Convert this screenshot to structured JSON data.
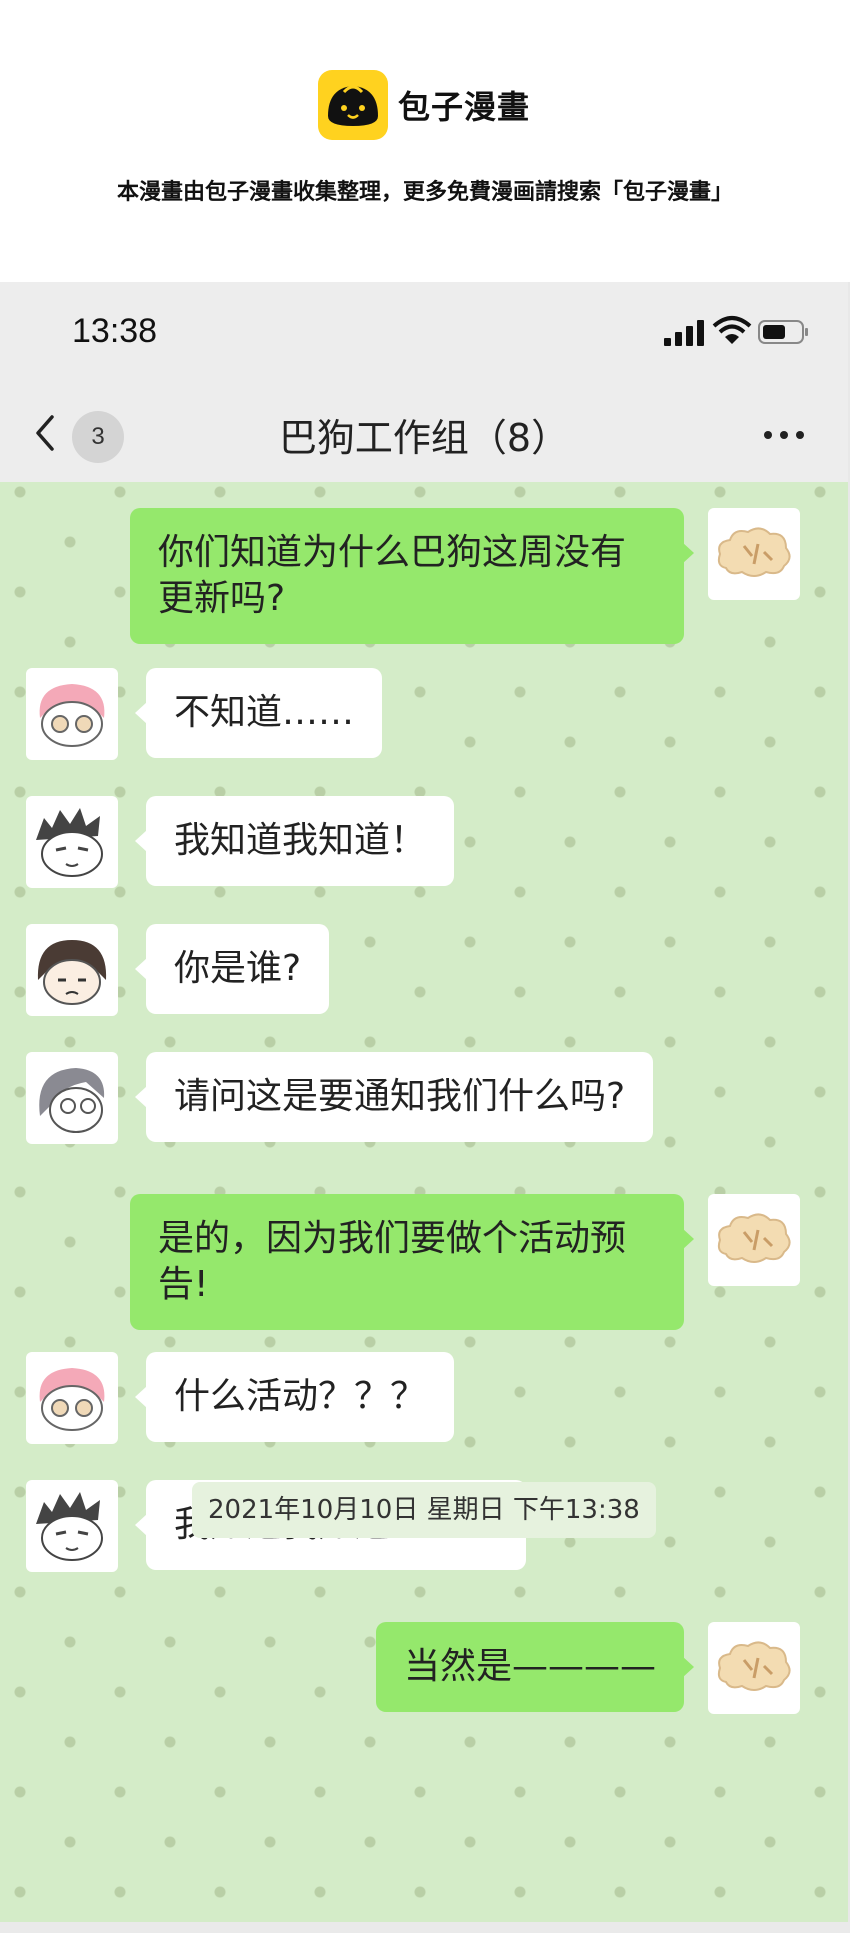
{
  "watermark": {
    "brand": "包子漫畫",
    "notice": "本漫畫由包子漫畫收集整理，更多免費漫画請搜索「包子漫畫」"
  },
  "status_bar": {
    "time": "13:38"
  },
  "nav": {
    "unread_count": "3",
    "title": "巴狗工作组（8）"
  },
  "messages": [
    {
      "side": "out",
      "text": "你们知道为什么巴狗这周没有更新吗?"
    },
    {
      "side": "in",
      "avatar": "pink-hair-glasses-avatar",
      "text": "不知道……"
    },
    {
      "side": "in",
      "avatar": "spiky-hair-avatar",
      "text": "我知道我知道！"
    },
    {
      "side": "in",
      "avatar": "bob-hair-avatar",
      "text": "你是谁?"
    },
    {
      "side": "in",
      "avatar": "gray-hair-glasses-avatar",
      "text": "请问这是要通知我们什么吗?"
    },
    {
      "side": "out",
      "text": "是的，因为我们要做个活动预告!"
    },
    {
      "side": "in",
      "avatar": "pink-hair-glasses-avatar",
      "text": "什么活动？？？"
    },
    {
      "side": "in",
      "avatar": "spiky-hair-avatar",
      "text": "我知道我知道！！！"
    },
    {
      "side": "out",
      "text": "当然是————"
    }
  ],
  "timestamp": "2021年10月10日 星期日 下午13:38",
  "colors": {
    "chat_bg": "#d4ecc8",
    "outgoing": "#95e86c",
    "incoming": "#ffffff",
    "brand": "#ffd21f"
  }
}
